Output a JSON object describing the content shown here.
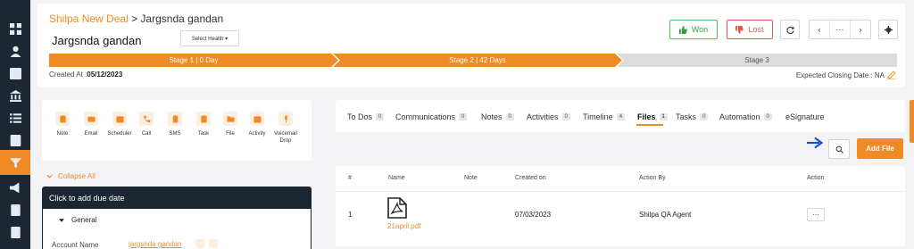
{
  "rail": {
    "icons": [
      "dashboard-icon",
      "contacts-icon",
      "tasks-icon",
      "accounts-icon",
      "list-icon",
      "profile-icon",
      "deals-filter-icon",
      "campaigns-icon",
      "documents-icon",
      "reports-icon"
    ]
  },
  "breadcrumb": {
    "parent": "Shilpa New Deal",
    "separator": ">",
    "current": "Jargsnda gandan"
  },
  "deal": {
    "title": "Jargsnda gandan",
    "health_label": "Select Health ▾"
  },
  "actions": {
    "won_label": "Won",
    "lost_label": "Lost",
    "more_label": "···",
    "prev_label": "‹",
    "next_label": "›"
  },
  "stages": [
    {
      "label": "Stage 1 | 0 Day"
    },
    {
      "label": "Stage 2 | 42 Days"
    },
    {
      "label": "Stage 3"
    }
  ],
  "created": {
    "label": "Created At :",
    "value": "05/12/2023"
  },
  "closing": {
    "label": "Expected Closing Date : NA"
  },
  "activities": [
    {
      "label": "Note"
    },
    {
      "label": "Email"
    },
    {
      "label": "Scheduler"
    },
    {
      "label": "Call"
    },
    {
      "label": "SMS"
    },
    {
      "label": "Task"
    },
    {
      "label": "File"
    },
    {
      "label": "Activity"
    },
    {
      "label": "Voicemail Drop"
    }
  ],
  "details": {
    "collapse_label": "Collapse All",
    "due_label": "Click to add due date",
    "section_label": "General",
    "account_label": "Account Name",
    "account_value": "jargsnda gandan"
  },
  "tabs": [
    {
      "label": "To Dos",
      "count": "0"
    },
    {
      "label": "Communications",
      "count": "0"
    },
    {
      "label": "Notes",
      "count": "0"
    },
    {
      "label": "Activities",
      "count": "0"
    },
    {
      "label": "Timeline",
      "count": "4"
    },
    {
      "label": "Files",
      "count": "1"
    },
    {
      "label": "Tasks",
      "count": "0"
    },
    {
      "label": "Automation",
      "count": "0"
    },
    {
      "label": "eSignature",
      "count": ""
    }
  ],
  "files": {
    "add_label": "Add File",
    "columns": [
      "#",
      "Name",
      "Note",
      "Created on",
      "Action By",
      "Action"
    ],
    "rows": [
      {
        "index": "1",
        "name": "21april.pdf",
        "note": "",
        "created_on": "07/03/2023",
        "action_by": "Shilpa QA Agent",
        "action": "···"
      }
    ]
  },
  "colors": {
    "accent": "#f08a24",
    "rail": "#1d2733",
    "won": "#5cb85c",
    "lost": "#e5564a",
    "pointer_arrow": "#1a4fd8"
  }
}
